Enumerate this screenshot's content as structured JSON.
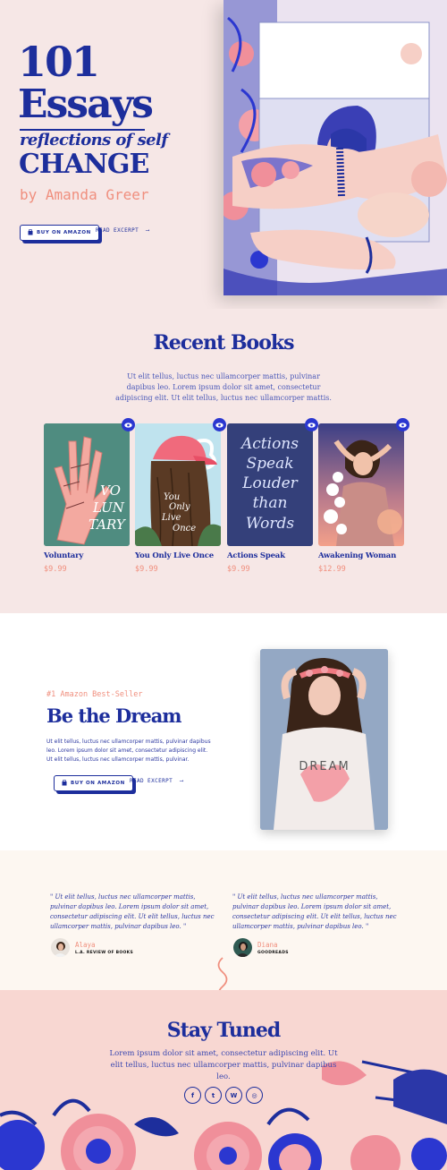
{
  "hero": {
    "title_number": "101",
    "title_word": "Essays",
    "subtitle": "reflections of self",
    "title_change": "CHANGE",
    "author": "by Amanda Greer",
    "buy_label": "BUY ON AMAZON",
    "excerpt_label": "READ EXCERPT"
  },
  "recent": {
    "heading": "Recent Books",
    "description": "Ut elit tellus, luctus nec ullamcorper mattis, pulvinar dapibus leo. Lorem ipsum dolor sit amet, consectetur adipiscing elit. Ut elit tellus, luctus nec ullamcorper mattis.",
    "books": [
      {
        "title": "Voluntary",
        "price": "$9.99"
      },
      {
        "title": "You Only Live Once",
        "price": "$9.99"
      },
      {
        "title": "Actions Speak",
        "price": "$9.99"
      },
      {
        "title": "Awakening Woman",
        "price": "$12.99"
      }
    ]
  },
  "covers": {
    "voluntary": [
      "VO",
      "LUN",
      "TARY"
    ],
    "yolo": [
      "You",
      "Only",
      "Live",
      "Once"
    ],
    "actions": [
      "Actions",
      "Speak",
      "Louder",
      "than",
      "Words"
    ],
    "dream_shirt": "DREAM"
  },
  "dream": {
    "kicker": "#1 Amazon Best-Seller",
    "heading": "Be the Dream",
    "description": "Ut elit tellus, luctus nec ullamcorper mattis, pulvinar dapibus leo. Lorem ipsum dolor sit amet, consectetur adipiscing elit. Ut elit tellus, luctus nec ullamcorper mattis, pulvinar.",
    "buy_label": "BUY ON AMAZON",
    "excerpt_label": "READ EXCERPT"
  },
  "testimonials": [
    {
      "quote": "\" Ut elit tellus, luctus nec ullamcorper mattis, pulvinar dapibus leo. Lorem ipsum dolor sit amet, consectetur adipiscing elit. Ut elit tellus, luctus nec ullamcorper mattis, pulvinar dapibus leo. \"",
      "name": "Alaya",
      "org": "L.A. REVIEW OF BOOKS"
    },
    {
      "quote": "\" Ut elit tellus, luctus nec ullamcorper mattis, pulvinar dapibus leo. Lorem ipsum dolor sit amet, consectetur adipiscing elit. Ut elit tellus, luctus nec ullamcorper mattis, pulvinar dapibus leo. \"",
      "name": "Diana",
      "org": "GOODREADS"
    }
  ],
  "stay": {
    "heading": "Stay Tuned",
    "description": "Lorem ipsum dolor sit amet, consectetur adipiscing elit. Ut elit tellus, luctus nec ullamcorper mattis, pulvinar dapibus leo.",
    "socials": [
      {
        "name": "facebook",
        "glyph": "f"
      },
      {
        "name": "twitter",
        "glyph": "t"
      },
      {
        "name": "wordpress",
        "glyph": "W"
      },
      {
        "name": "instagram",
        "glyph": "◎"
      }
    ]
  },
  "colors": {
    "navy": "#1d2e9c",
    "salmon": "#f08f7e",
    "blush": "#f6e7e6",
    "eye": "#2b37d0"
  },
  "icons": {
    "eye": "eye-icon",
    "bag": "shopping-bag-icon",
    "arrow": "arrow-right-icon",
    "squiggle": "squiggle-divider"
  }
}
